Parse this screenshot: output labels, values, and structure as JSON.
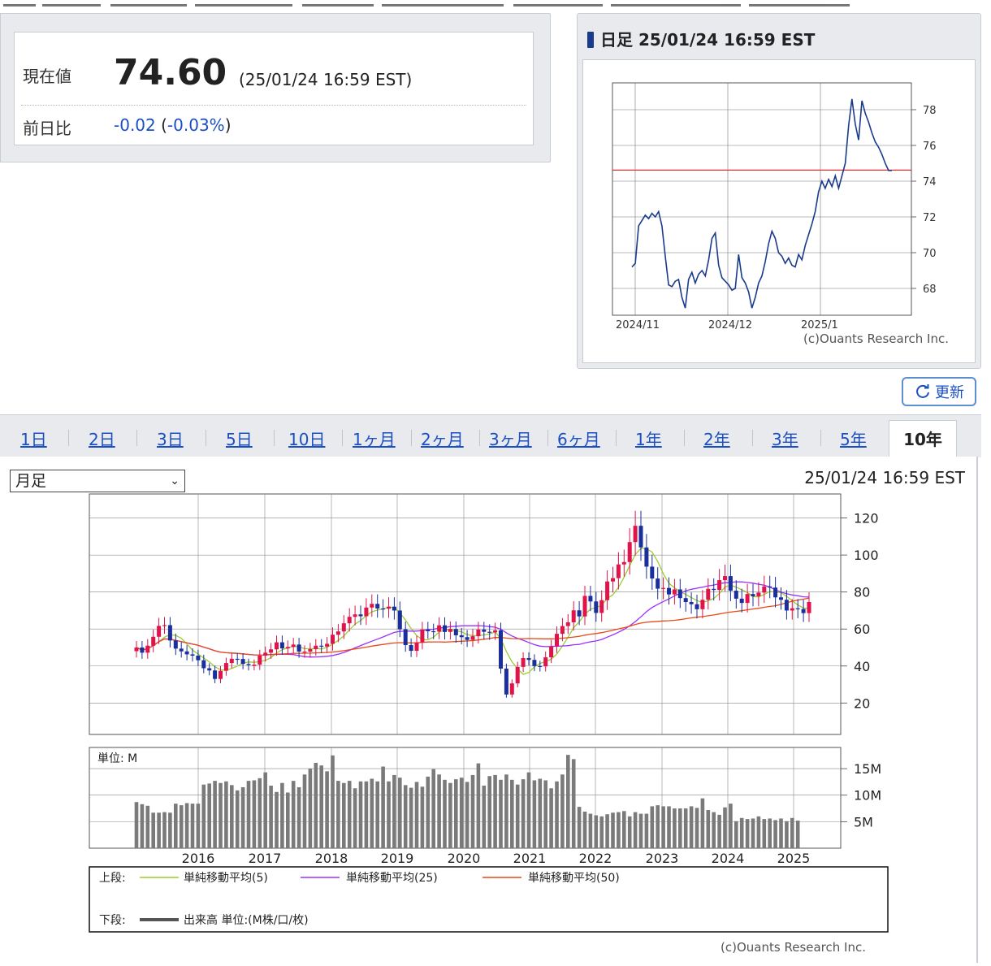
{
  "quote": {
    "price_label": "現在値",
    "price": "74.60",
    "time": "(25/01/24 16:59 EST)",
    "change_label": "前日比",
    "change_abs": "-0.02",
    "change_open": " (",
    "change_pct": "-0.03%",
    "change_close": ")"
  },
  "mini_chart": {
    "header": "日足 25/01/24 16:59 EST",
    "credit": "(c)Ouants Research Inc.",
    "chart_data": {
      "type": "line",
      "x_ticks": [
        "2024/11",
        "2024/12",
        "2025/1"
      ],
      "y_ticks": [
        68,
        70,
        72,
        74,
        76,
        78
      ],
      "ylim": [
        66.5,
        79.5
      ],
      "reference_line": 74.62,
      "series": [
        {
          "values": [
            69.2,
            69.4,
            71.5,
            71.8,
            72.1,
            71.9,
            72.2,
            72.0,
            72.3,
            71.5,
            69.8,
            68.2,
            68.1,
            68.4,
            68.5,
            67.5,
            66.9,
            68.5,
            68.9,
            68.3,
            68.8,
            69.0,
            68.7,
            69.6,
            70.8,
            71.1,
            69.3,
            68.6,
            68.4,
            68.2,
            67.9,
            68.0,
            69.9,
            68.6,
            68.3,
            67.8,
            66.9,
            67.5,
            68.3,
            68.7,
            69.5,
            70.5,
            71.2,
            70.8,
            70.0,
            69.8,
            69.4,
            69.7,
            69.3,
            69.2,
            69.9,
            69.6,
            70.4,
            71.0,
            71.6,
            72.3,
            73.4,
            74.0,
            73.6,
            74.1,
            73.7,
            74.3,
            73.6,
            74.3,
            75.0,
            77.1,
            78.6,
            77.2,
            76.3,
            78.5,
            77.8,
            77.3,
            76.7,
            76.2,
            75.9,
            75.5,
            75.0,
            74.6,
            74.6
          ]
        }
      ]
    }
  },
  "refresh_label": "更新",
  "tabs": [
    "1日",
    "2日",
    "3日",
    "5日",
    "10日",
    "1ヶ月",
    "2ヶ月",
    "3ヶ月",
    "6ヶ月",
    "1年",
    "2年",
    "3年",
    "5年"
  ],
  "tab_active": "10年",
  "select_value": "月足",
  "main_time": "25/01/24 16:59 EST",
  "main_chart": {
    "price_chart": {
      "type": "candlestick",
      "x_ticks": [
        "2016",
        "2017",
        "2018",
        "2019",
        "2020",
        "2021",
        "2022",
        "2023",
        "2024",
        "2025"
      ],
      "y_ticks": [
        20,
        40,
        60,
        80,
        100,
        120
      ],
      "ylim": [
        3,
        133
      ],
      "closes": [
        50.0,
        47.2,
        51.0,
        55.8,
        61.7,
        62.1,
        53.8,
        49.4,
        47.9,
        46.3,
        45.6,
        43.1,
        38.8,
        37.6,
        33.0,
        37.4,
        41.6,
        43.9,
        43.8,
        41.1,
        40.5,
        40.7,
        45.6,
        47.2,
        49.0,
        52.8,
        49.5,
        50.3,
        51.6,
        47.8,
        47.8,
        49.1,
        51.0,
        50.5,
        52.0,
        56.9,
        58.7,
        63.1,
        66.6,
        67.9,
        66.9,
        71.6,
        73.6,
        71.1,
        71.0,
        72.1,
        70.0,
        59.8,
        51.3,
        48.2,
        52.7,
        59.7,
        58.8,
        58.6,
        62.0,
        58.4,
        59.9,
        56.6,
        55.6,
        54.1,
        56.1,
        59.7,
        58.5,
        58.2,
        59.3,
        38.6,
        24.6,
        30.6,
        39.5,
        44.3,
        43.3,
        40.0,
        39.8,
        44.7,
        50.6,
        57.4,
        61.6,
        63.6,
        70.1,
        66.8,
        77.9,
        74.9,
        68.7,
        75.6,
        85.7,
        87.5,
        94.9,
        96.2,
        107.0,
        115.8,
        104.1,
        93.7,
        87.3,
        81.8,
        82.2,
        78.7,
        81.4,
        76.7,
        74.6,
        73.4,
        70.7,
        75.8,
        81.7,
        81.1,
        86.4,
        88.6,
        80.7,
        76.4,
        74.1,
        78.9,
        77.7,
        79.7,
        83.0,
        82.4,
        77.1,
        75.8,
        70.0,
        71.2,
        70.8,
        68.6,
        74.6
      ],
      "moving_averages": [
        {
          "name": "単純移動平均(5)",
          "color": "#9acd32"
        },
        {
          "name": "単純移動平均(25)",
          "color": "#9b30ff"
        },
        {
          "name": "単純移動平均(50)",
          "color": "#e84a1a"
        }
      ]
    },
    "volume_chart": {
      "type": "bar",
      "unit_label": "単位: M",
      "y_ticks": [
        "15M",
        "10M",
        "5M"
      ],
      "ylim": [
        0,
        19
      ],
      "values": [
        8.7,
        8.3,
        8.0,
        6.7,
        6.7,
        6.8,
        6.7,
        8.4,
        8.1,
        8.5,
        8.4,
        8.4,
        12.0,
        12.2,
        12.7,
        12.3,
        12.6,
        11.9,
        10.9,
        11.5,
        12.7,
        12.8,
        13.2,
        14.3,
        11.8,
        10.6,
        12.3,
        10.5,
        12.7,
        11.5,
        13.9,
        15.0,
        16.1,
        15.6,
        14.5,
        17.5,
        12.7,
        12.3,
        12.7,
        11.3,
        12.6,
        12.6,
        13.1,
        12.6,
        15.4,
        12.6,
        13.8,
        13.3,
        11.9,
        11.4,
        12.5,
        11.6,
        13.5,
        14.9,
        13.9,
        12.9,
        12.3,
        13.0,
        13.3,
        12.5,
        13.8,
        16.0,
        11.8,
        13.6,
        13.8,
        12.9,
        13.9,
        12.9,
        12.0,
        13.0,
        14.3,
        12.8,
        13.1,
        12.8,
        11.3,
        12.6,
        13.9,
        17.6,
        16.8,
        7.8,
        6.9,
        6.5,
        6.2,
        6.0,
        6.4,
        6.7,
        6.8,
        7.0,
        6.0,
        6.8,
        6.5,
        6.5,
        7.9,
        8.1,
        7.9,
        7.9,
        7.5,
        7.5,
        7.5,
        7.9,
        7.6,
        9.4,
        7.2,
        6.8,
        6.3,
        7.7,
        8.4,
        5.1,
        5.7,
        5.5,
        5.6,
        6.0,
        5.5,
        5.6,
        5.3,
        5.6,
        5.1,
        5.7,
        5.2
      ],
      "bar_color": "#7a7a7a"
    },
    "legend": {
      "upper_label": "上段:",
      "lower_label": "下段:",
      "volume_label": "出来高 単位:(M株/口/枚)"
    },
    "credit": "(c)Ouants Research Inc."
  }
}
